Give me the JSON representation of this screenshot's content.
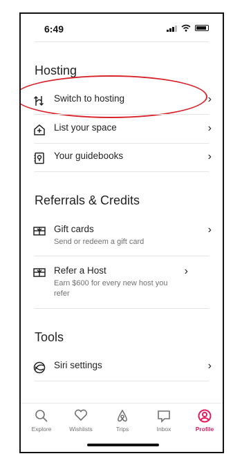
{
  "status_bar": {
    "time": "6:49"
  },
  "colors": {
    "accent": "#e31c5f",
    "highlight_circle": "#d8252c"
  },
  "sections": {
    "hosting": {
      "title": "Hosting",
      "items": [
        {
          "label": "Switch to hosting",
          "icon": "switch-arrows-icon"
        },
        {
          "label": "List your space",
          "icon": "add-home-icon"
        },
        {
          "label": "Your guidebooks",
          "icon": "guidebook-icon"
        }
      ]
    },
    "referrals": {
      "title": "Referrals & Credits",
      "items": [
        {
          "label": "Gift cards",
          "sub": "Send or redeem a gift card",
          "icon": "gift-card-icon"
        },
        {
          "label": "Refer a Host",
          "sub": "Earn $600 for every new host you refer",
          "icon": "gift-card-icon"
        }
      ]
    },
    "tools": {
      "title": "Tools",
      "items": [
        {
          "label": "Siri settings",
          "icon": "siri-icon"
        }
      ]
    }
  },
  "tabbar": {
    "tabs": [
      {
        "label": "Explore",
        "icon": "search-icon"
      },
      {
        "label": "Wishlists",
        "icon": "heart-icon"
      },
      {
        "label": "Trips",
        "icon": "airbnb-logo-icon"
      },
      {
        "label": "Inbox",
        "icon": "message-icon"
      },
      {
        "label": "Profile",
        "icon": "profile-icon",
        "active": true
      }
    ]
  }
}
